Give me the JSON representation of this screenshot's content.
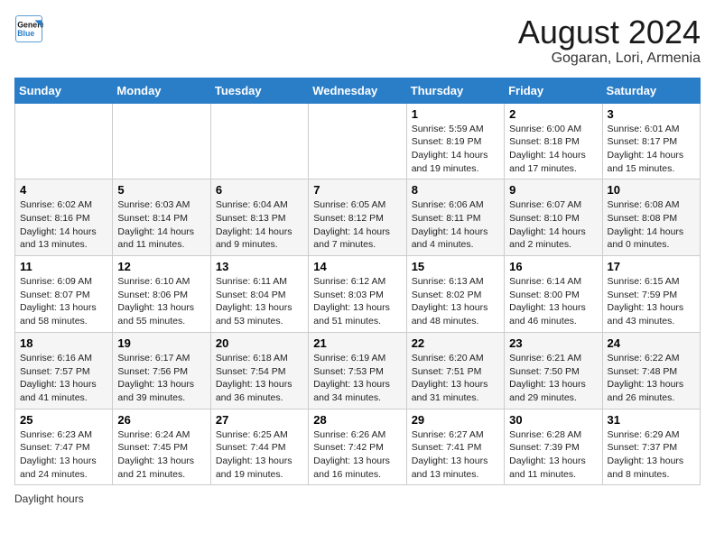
{
  "header": {
    "logo_line1": "General",
    "logo_line2": "Blue",
    "title": "August 2024",
    "subtitle": "Gogaran, Lori, Armenia"
  },
  "calendar": {
    "days_of_week": [
      "Sunday",
      "Monday",
      "Tuesday",
      "Wednesday",
      "Thursday",
      "Friday",
      "Saturday"
    ],
    "weeks": [
      [
        {
          "day": "",
          "info": ""
        },
        {
          "day": "",
          "info": ""
        },
        {
          "day": "",
          "info": ""
        },
        {
          "day": "",
          "info": ""
        },
        {
          "day": "1",
          "info": "Sunrise: 5:59 AM\nSunset: 8:19 PM\nDaylight: 14 hours and 19 minutes."
        },
        {
          "day": "2",
          "info": "Sunrise: 6:00 AM\nSunset: 8:18 PM\nDaylight: 14 hours and 17 minutes."
        },
        {
          "day": "3",
          "info": "Sunrise: 6:01 AM\nSunset: 8:17 PM\nDaylight: 14 hours and 15 minutes."
        }
      ],
      [
        {
          "day": "4",
          "info": "Sunrise: 6:02 AM\nSunset: 8:16 PM\nDaylight: 14 hours and 13 minutes."
        },
        {
          "day": "5",
          "info": "Sunrise: 6:03 AM\nSunset: 8:14 PM\nDaylight: 14 hours and 11 minutes."
        },
        {
          "day": "6",
          "info": "Sunrise: 6:04 AM\nSunset: 8:13 PM\nDaylight: 14 hours and 9 minutes."
        },
        {
          "day": "7",
          "info": "Sunrise: 6:05 AM\nSunset: 8:12 PM\nDaylight: 14 hours and 7 minutes."
        },
        {
          "day": "8",
          "info": "Sunrise: 6:06 AM\nSunset: 8:11 PM\nDaylight: 14 hours and 4 minutes."
        },
        {
          "day": "9",
          "info": "Sunrise: 6:07 AM\nSunset: 8:10 PM\nDaylight: 14 hours and 2 minutes."
        },
        {
          "day": "10",
          "info": "Sunrise: 6:08 AM\nSunset: 8:08 PM\nDaylight: 14 hours and 0 minutes."
        }
      ],
      [
        {
          "day": "11",
          "info": "Sunrise: 6:09 AM\nSunset: 8:07 PM\nDaylight: 13 hours and 58 minutes."
        },
        {
          "day": "12",
          "info": "Sunrise: 6:10 AM\nSunset: 8:06 PM\nDaylight: 13 hours and 55 minutes."
        },
        {
          "day": "13",
          "info": "Sunrise: 6:11 AM\nSunset: 8:04 PM\nDaylight: 13 hours and 53 minutes."
        },
        {
          "day": "14",
          "info": "Sunrise: 6:12 AM\nSunset: 8:03 PM\nDaylight: 13 hours and 51 minutes."
        },
        {
          "day": "15",
          "info": "Sunrise: 6:13 AM\nSunset: 8:02 PM\nDaylight: 13 hours and 48 minutes."
        },
        {
          "day": "16",
          "info": "Sunrise: 6:14 AM\nSunset: 8:00 PM\nDaylight: 13 hours and 46 minutes."
        },
        {
          "day": "17",
          "info": "Sunrise: 6:15 AM\nSunset: 7:59 PM\nDaylight: 13 hours and 43 minutes."
        }
      ],
      [
        {
          "day": "18",
          "info": "Sunrise: 6:16 AM\nSunset: 7:57 PM\nDaylight: 13 hours and 41 minutes."
        },
        {
          "day": "19",
          "info": "Sunrise: 6:17 AM\nSunset: 7:56 PM\nDaylight: 13 hours and 39 minutes."
        },
        {
          "day": "20",
          "info": "Sunrise: 6:18 AM\nSunset: 7:54 PM\nDaylight: 13 hours and 36 minutes."
        },
        {
          "day": "21",
          "info": "Sunrise: 6:19 AM\nSunset: 7:53 PM\nDaylight: 13 hours and 34 minutes."
        },
        {
          "day": "22",
          "info": "Sunrise: 6:20 AM\nSunset: 7:51 PM\nDaylight: 13 hours and 31 minutes."
        },
        {
          "day": "23",
          "info": "Sunrise: 6:21 AM\nSunset: 7:50 PM\nDaylight: 13 hours and 29 minutes."
        },
        {
          "day": "24",
          "info": "Sunrise: 6:22 AM\nSunset: 7:48 PM\nDaylight: 13 hours and 26 minutes."
        }
      ],
      [
        {
          "day": "25",
          "info": "Sunrise: 6:23 AM\nSunset: 7:47 PM\nDaylight: 13 hours and 24 minutes."
        },
        {
          "day": "26",
          "info": "Sunrise: 6:24 AM\nSunset: 7:45 PM\nDaylight: 13 hours and 21 minutes."
        },
        {
          "day": "27",
          "info": "Sunrise: 6:25 AM\nSunset: 7:44 PM\nDaylight: 13 hours and 19 minutes."
        },
        {
          "day": "28",
          "info": "Sunrise: 6:26 AM\nSunset: 7:42 PM\nDaylight: 13 hours and 16 minutes."
        },
        {
          "day": "29",
          "info": "Sunrise: 6:27 AM\nSunset: 7:41 PM\nDaylight: 13 hours and 13 minutes."
        },
        {
          "day": "30",
          "info": "Sunrise: 6:28 AM\nSunset: 7:39 PM\nDaylight: 13 hours and 11 minutes."
        },
        {
          "day": "31",
          "info": "Sunrise: 6:29 AM\nSunset: 7:37 PM\nDaylight: 13 hours and 8 minutes."
        }
      ]
    ]
  },
  "footer": {
    "note": "Daylight hours"
  }
}
